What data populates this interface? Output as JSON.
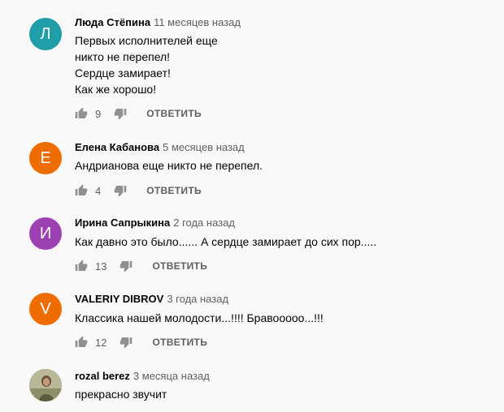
{
  "comments": [
    {
      "avatar_letter": "Л",
      "avatar_color": "#1f9ea8",
      "author": "Люда Стёпина",
      "time": "11 месяцев назад",
      "text": "Первых исполнителей еще\nникто не перепел!\nСердце замирает!\nКак же хорошо!",
      "likes": "9",
      "reply_label": "ОТВЕТИТЬ"
    },
    {
      "avatar_letter": "Е",
      "avatar_color": "#ef6c00",
      "author": "Елена Кабанова",
      "time": "5 месяцев назад",
      "text": "Андрианова еще никто не перепел.",
      "likes": "4",
      "reply_label": "ОТВЕТИТЬ"
    },
    {
      "avatar_letter": "И",
      "avatar_color": "#9c3fb0",
      "author": "Ирина Сапрыкина",
      "time": "2 года назад",
      "text": "Как давно это было...... А сердце замирает до сих пор.....",
      "likes": "13",
      "reply_label": "ОТВЕТИТЬ"
    },
    {
      "avatar_letter": "V",
      "avatar_color": "#ef6c00",
      "author": "VALERIY DIBROV",
      "time": "3 года назад",
      "text": "Классика нашей молодости...!!!!   Бравоoooo...!!!",
      "likes": "12",
      "reply_label": "ОТВЕТИТЬ"
    },
    {
      "avatar_letter": "",
      "avatar_color": "#6b6a4a",
      "author": "rozal berez",
      "time": "3 месяца назад",
      "text": "прекрасно звучит",
      "likes": "",
      "reply_label": ""
    }
  ]
}
